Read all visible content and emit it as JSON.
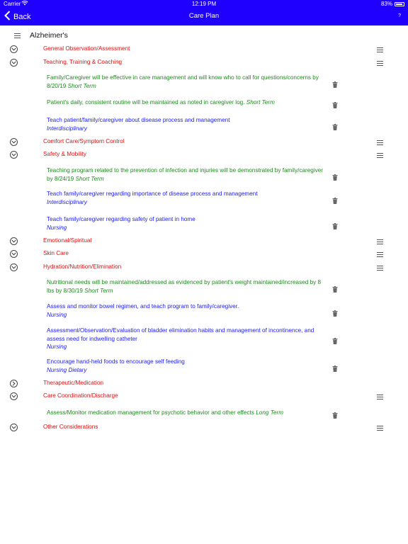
{
  "status_bar": {
    "carrier": "Carrier",
    "time": "12:19 PM",
    "battery": "83%"
  },
  "nav": {
    "back_label": "Back",
    "title": "Care Plan",
    "help": "?"
  },
  "plan": {
    "title": "Alzheimer's"
  },
  "categories": [
    {
      "label": "General Observation/Assessment",
      "expanded": true,
      "items": []
    },
    {
      "label": "Teaching, Training & Coaching",
      "expanded": true,
      "items": [
        {
          "text": "Family/Caregiver will be effective in care management and will know who to call for questions/concerns by 8/20/19",
          "suffix": "Short Term",
          "color": "green"
        },
        {
          "text": "Patient's daily, consistent routine will be maintained as noted in caregiver log.",
          "suffix": "Short Term",
          "color": "green"
        },
        {
          "text": "Teach patient/family/caregiver about disease process and management",
          "sub": "Interdisciplinary",
          "color": "blue"
        }
      ]
    },
    {
      "label": "Comfort Care/Symptom Control",
      "expanded": true,
      "items": []
    },
    {
      "label": "Safety & Mobility",
      "expanded": true,
      "items": [
        {
          "text": "Teaching program related to the prevention of infection and injuries will be demonstrated by family/caregiver by 8/24/19",
          "suffix": "Short Term",
          "color": "green"
        },
        {
          "text": "Teach family/caregiver regarding importance of disease process and management",
          "sub": "Interdisciplinary",
          "color": "blue"
        },
        {
          "text": "Teach family/caregiver regarding safety of patient in home",
          "sub": "Nursing",
          "color": "blue"
        }
      ]
    },
    {
      "label": "Emotional/Spiritual",
      "expanded": true,
      "items": []
    },
    {
      "label": "Skin Care",
      "expanded": true,
      "items": []
    },
    {
      "label": "Hydration/Nutrition/Elimination",
      "expanded": true,
      "items": [
        {
          "text": "Nutritional needs will be maintained/addressed as evidenced by patient's weight maintained/increased by 8 lbs by 8/30/19",
          "suffix": "Short Term",
          "color": "green"
        },
        {
          "text": "Assess and monitor bowel regimen, and teach program to family/caregiver.",
          "sub": "Nursing",
          "color": "blue"
        },
        {
          "text": "Assessment/Observation/Evaluation of bladder elimination habits and management of incontinence, and assess need for indwelling catheter",
          "sub": "Nursing",
          "color": "blue"
        },
        {
          "text": "Encourage hand-held foods to encourage self feeding",
          "sub": "Nursing Dietary",
          "color": "blue"
        }
      ]
    },
    {
      "label": "Therapeutic/Medication",
      "expanded": false,
      "items": []
    },
    {
      "label": "Care Coordination/Discharge",
      "expanded": true,
      "items": [
        {
          "text": "Assess/Monitor medication management for psychotic behavior and other effects",
          "suffix": "Long Term",
          "color": "green"
        }
      ]
    },
    {
      "label": "Other Considerations",
      "expanded": true,
      "items": []
    }
  ],
  "icons": {
    "expand": "chevron-down-circle-icon",
    "collapsed": "chevron-right-circle-icon",
    "reorder": "reorder-icon",
    "delete": "trash-icon",
    "menu": "menu-icon"
  },
  "colors": {
    "nav": "#1f00ff",
    "category": "#e01010",
    "goal": "#1d8a1d",
    "intervention": "#1a1aff"
  }
}
